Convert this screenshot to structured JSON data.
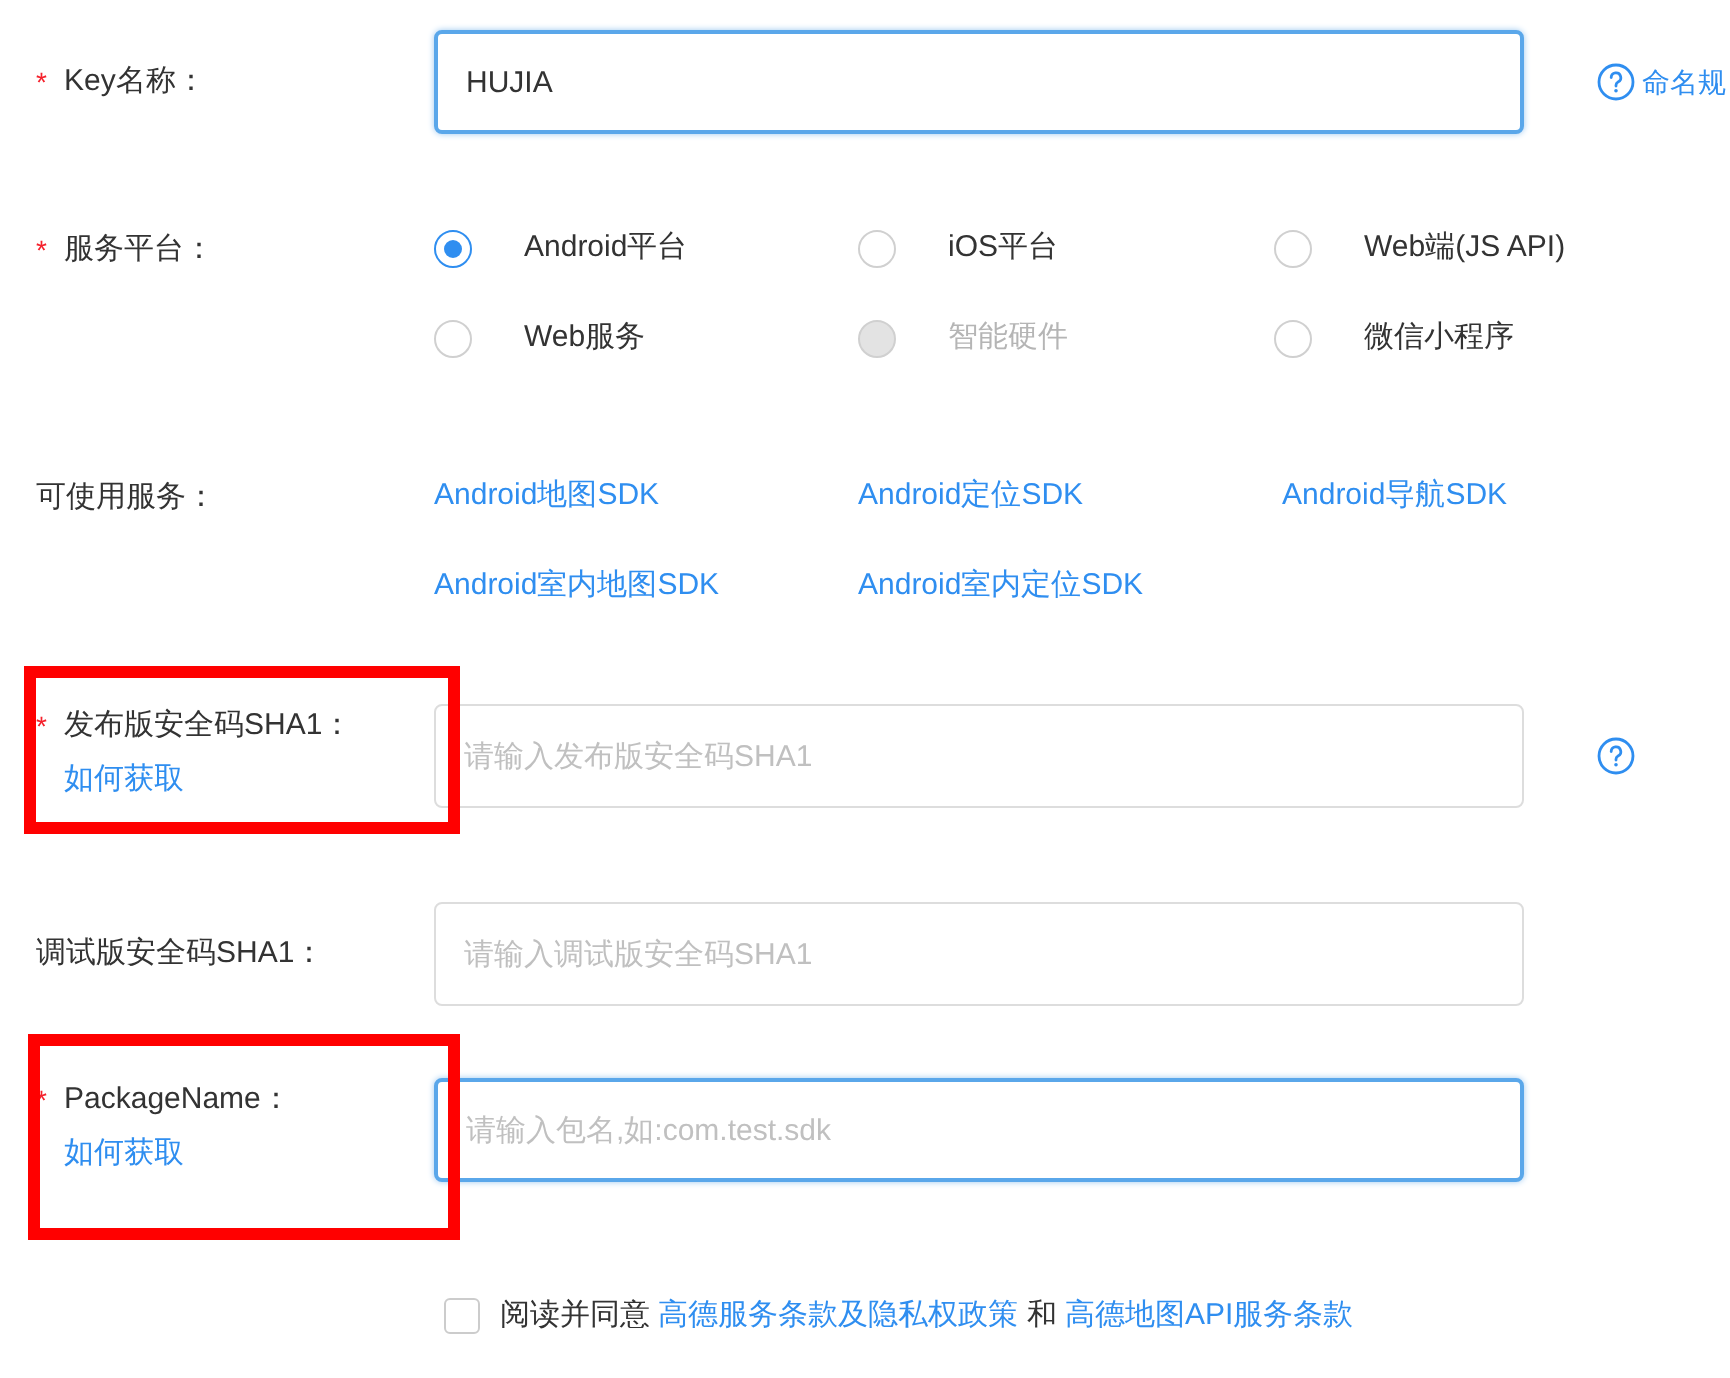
{
  "fields": [
    {
      "kind": "input",
      "label": "Key名称：",
      "required_mark": "*",
      "value": "HUJIA",
      "focused": true,
      "help_icon": true,
      "help_text": "命名规",
      "highlighted": false
    },
    {
      "kind": "radio",
      "label": "服务平台：",
      "required_mark": "*",
      "options": [
        {
          "label": "Android平台",
          "selected": true,
          "disabled": false
        },
        {
          "label": "iOS平台",
          "selected": false,
          "disabled": false
        },
        {
          "label": "Web端(JS API)",
          "selected": false,
          "disabled": false
        },
        {
          "label": "Web服务",
          "selected": false,
          "disabled": false
        },
        {
          "label": "智能硬件",
          "selected": false,
          "disabled": true
        },
        {
          "label": "微信小程序",
          "selected": false,
          "disabled": false
        }
      ]
    },
    {
      "kind": "links",
      "label": "可使用服务：",
      "links": [
        "Android地图SDK",
        "Android定位SDK",
        "Android导航SDK",
        "Android室内地图SDK",
        "Android室内定位SDK"
      ]
    },
    {
      "kind": "input",
      "label": "发布版安全码SHA1：",
      "required_mark": "*",
      "link": "如何获取",
      "placeholder": "请输入发布版安全码SHA1",
      "focused": false,
      "help_icon": true,
      "highlighted": true
    },
    {
      "kind": "input",
      "label": "调试版安全码SHA1：",
      "placeholder": "请输入调试版安全码SHA1",
      "focused": false,
      "help_icon": false,
      "highlighted": false
    },
    {
      "kind": "input",
      "label": "PackageName：",
      "required_mark": "*",
      "link": "如何获取",
      "placeholder": "请输入包名,如:com.test.sdk",
      "focused": true,
      "help_icon": false,
      "highlighted": true
    }
  ],
  "agreement": {
    "checked": false,
    "prefix": "阅读并同意",
    "link_1": "高德服务条款及隐私权政策",
    "joiner": "和",
    "link_2": "高德地图API服务条款"
  }
}
